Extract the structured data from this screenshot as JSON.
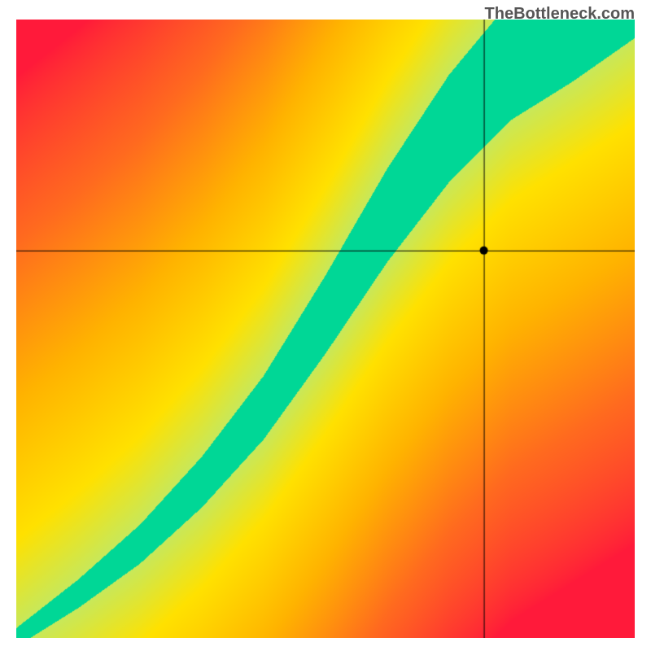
{
  "watermark": "TheBottleneck.com",
  "chart_data": {
    "type": "heatmap",
    "title": "",
    "xlabel": "",
    "ylabel": "",
    "x_range": [
      0,
      1
    ],
    "y_range": [
      0,
      1
    ],
    "crosshair": {
      "x": 0.757,
      "y": 0.626
    },
    "marker": {
      "x": 0.757,
      "y": 0.626
    },
    "ridge_points": [
      {
        "x": 0.0,
        "y": 0.0
      },
      {
        "x": 0.1,
        "y": 0.07
      },
      {
        "x": 0.2,
        "y": 0.15
      },
      {
        "x": 0.3,
        "y": 0.25
      },
      {
        "x": 0.4,
        "y": 0.37
      },
      {
        "x": 0.5,
        "y": 0.52
      },
      {
        "x": 0.6,
        "y": 0.68
      },
      {
        "x": 0.7,
        "y": 0.82
      },
      {
        "x": 0.8,
        "y": 0.93
      },
      {
        "x": 0.9,
        "y": 1.0
      }
    ],
    "ridge_width_start": 0.015,
    "ridge_width_end": 0.1,
    "color_scale": [
      {
        "t": 0.0,
        "color": "#ff1a3a"
      },
      {
        "t": 0.35,
        "color": "#ff6a1f"
      },
      {
        "t": 0.6,
        "color": "#ffb300"
      },
      {
        "t": 0.8,
        "color": "#ffe100"
      },
      {
        "t": 0.92,
        "color": "#c8e85a"
      },
      {
        "t": 1.0,
        "color": "#00d796"
      }
    ],
    "notes": "Heatmap value at (x,y) is proximity to the optimal ridge curve. Green = on ridge (bottleneck-free), red = far from ridge. Ridge thickness grows from ~0.015 at origin to ~0.10 at top-right."
  }
}
